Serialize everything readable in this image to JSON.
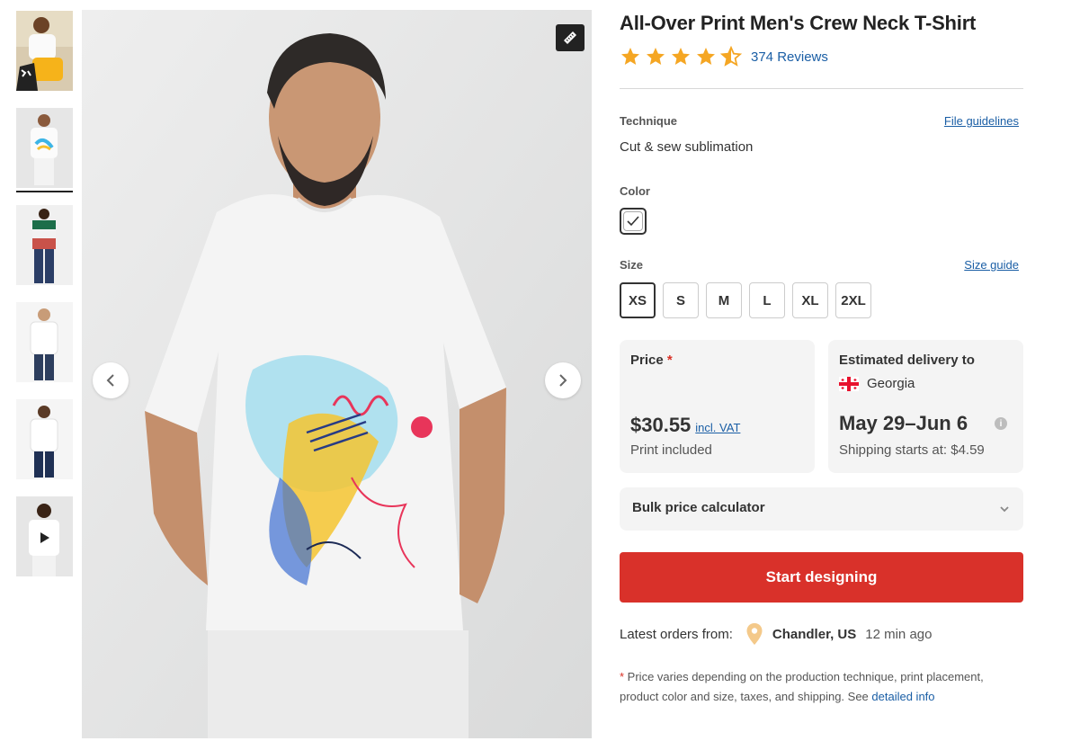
{
  "product": {
    "title": "All-Over Print Men's Crew Neck T-Shirt",
    "rating_stars": 4.5,
    "reviews_label": "374 Reviews"
  },
  "technique": {
    "label": "Technique",
    "guidelines_link": "File guidelines",
    "value": "Cut & sew sublimation"
  },
  "color": {
    "label": "Color",
    "selected": "white"
  },
  "size": {
    "label": "Size",
    "guide_link": "Size guide",
    "options": [
      "XS",
      "S",
      "M",
      "L",
      "XL",
      "2XL"
    ],
    "selected": "XS"
  },
  "price": {
    "label": "Price",
    "required_mark": "*",
    "amount": "$30.55",
    "vat": "incl. VAT",
    "note": "Print included"
  },
  "delivery": {
    "label": "Estimated delivery to",
    "country": "Georgia",
    "dates": "May 29–Jun 6",
    "info_icon": "i",
    "shipping": "Shipping starts at: $4.59"
  },
  "bulk": {
    "label": "Bulk price calculator"
  },
  "cta": {
    "label": "Start designing"
  },
  "latest_orders": {
    "label": "Latest orders from:",
    "city": "Chandler, US",
    "ago": "12 min ago"
  },
  "footnote": {
    "mark": "*",
    "text": " Price varies depending on the production technique, print placement, product color and size, taxes, and shipping. See ",
    "link": "detailed info"
  },
  "icons": {
    "ruler": "ruler-icon",
    "prev": "chevron-left-icon",
    "next": "chevron-right-icon",
    "play": "play-icon",
    "star": "star-icon",
    "pin": "location-pin-icon",
    "flag": "georgia-flag-icon",
    "chevron_down": "chevron-down-icon",
    "check": "check-icon"
  },
  "colors": {
    "accent": "#d9312a",
    "link": "#1a5ea5",
    "star": "#f5a623"
  }
}
